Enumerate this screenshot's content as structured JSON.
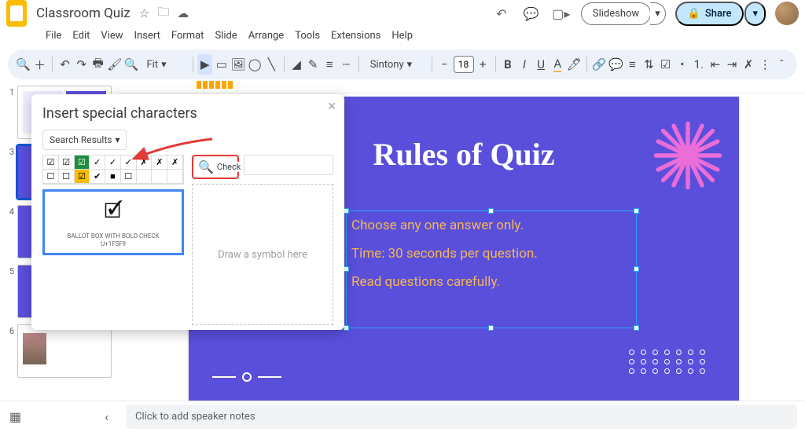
{
  "document": {
    "title": "Classroom Quiz"
  },
  "menu": {
    "file": "File",
    "edit": "Edit",
    "view": "View",
    "insert": "Insert",
    "format": "Format",
    "slide": "Slide",
    "arrange": "Arrange",
    "tools": "Tools",
    "extensions": "Extensions",
    "help": "Help"
  },
  "toolbar": {
    "zoom": "Fit",
    "font": "Sintony",
    "fontsize": "18",
    "slideshow": "Slideshow",
    "share": "Share"
  },
  "slide": {
    "title": "Rules of Quiz",
    "rules": [
      "Choose any one answer only.",
      "Time: 30 seconds per question.",
      "Read questions carefully."
    ]
  },
  "filmstrip": {
    "count": 6,
    "selected": 3
  },
  "dialog": {
    "title": "Insert special characters",
    "category": "Search Results",
    "search_value": "Check",
    "preview_name": "BALLOT BOX WITH BOLD CHECK",
    "preview_code": "U+1F5F9",
    "draw_hint": "Draw a symbol here",
    "grid": [
      "☑",
      "☑",
      "☑",
      "✓",
      "✓",
      "✓",
      "✗",
      "✗",
      "✗",
      "☐",
      "☐",
      "☑",
      "✔",
      "■",
      "☐",
      "",
      "",
      ""
    ]
  },
  "notes": {
    "placeholder": "Click to add speaker notes"
  },
  "colors": {
    "accent": "#5a4fdb",
    "rule_text": "#f5b556",
    "share_bg": "#c2e7ff"
  }
}
